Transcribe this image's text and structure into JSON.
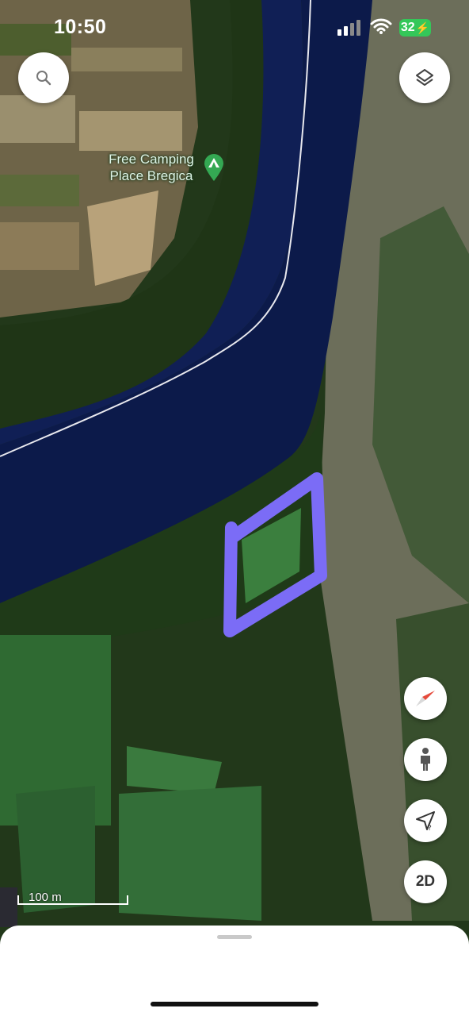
{
  "status_bar": {
    "time": "10:50",
    "battery_level": "32",
    "signal_bars_filled": 2,
    "signal_bars_total": 4
  },
  "map": {
    "view": "satellite",
    "poi": {
      "name_line1": "Free Camping",
      "name_line2": "Place Bregica",
      "icon": "camping-tent-icon",
      "color": "#34a853"
    },
    "drawn_shape_color": "#7b6cf6",
    "scale_label": "100 m"
  },
  "controls": {
    "search_icon": "search-icon",
    "layers_icon": "layers-icon",
    "compass_icon": "compass-icon",
    "street_view_icon": "person-icon",
    "location_icon": "location-arrow-icon",
    "view_mode_label": "2D"
  },
  "colors": {
    "river": "#0c1a4a",
    "vegetation": "#2b4a1f",
    "bank": "#7a7a68",
    "battery": "#34c759"
  }
}
